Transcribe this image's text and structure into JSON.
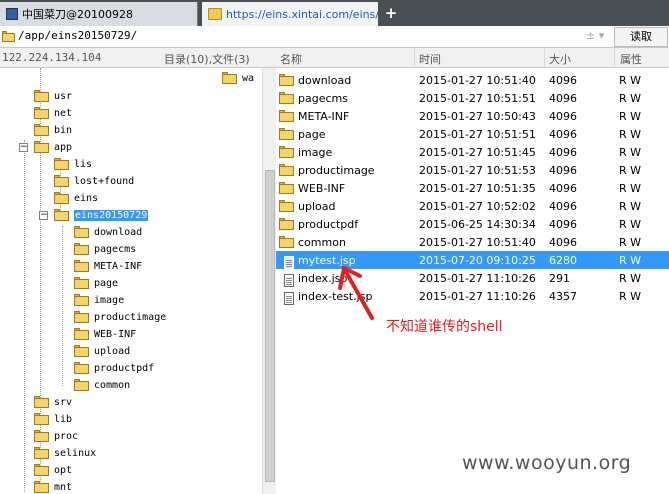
{
  "tabs": [
    {
      "label": "中国菜刀@20100928"
    },
    {
      "label": "https://eins.xintai.com/eins/u..."
    }
  ],
  "new_tab_label": "+",
  "address": {
    "path": "/app/eins20150729/",
    "control": "±  ▾",
    "read_button": "读取"
  },
  "left_status": {
    "ip": "122.224.134.104",
    "count": "目录(10),文件(3)"
  },
  "columns": {
    "name": "名称",
    "time": "时间",
    "size": "大小",
    "attr": "属性"
  },
  "tree": {
    "truncated_top": "wa",
    "items": [
      {
        "label": "usr",
        "depth": 1
      },
      {
        "label": "net",
        "depth": 1
      },
      {
        "label": "bin",
        "depth": 1
      },
      {
        "label": "app",
        "depth": 1,
        "expander": "−"
      },
      {
        "label": "lis",
        "depth": 2
      },
      {
        "label": "lost+found",
        "depth": 2
      },
      {
        "label": "eins",
        "depth": 2
      },
      {
        "label": "eins20150729",
        "depth": 2,
        "expander": "−",
        "selected": true
      },
      {
        "label": "download",
        "depth": 3
      },
      {
        "label": "pagecms",
        "depth": 3
      },
      {
        "label": "META-INF",
        "depth": 3
      },
      {
        "label": "page",
        "depth": 3
      },
      {
        "label": "image",
        "depth": 3
      },
      {
        "label": "productimage",
        "depth": 3
      },
      {
        "label": "WEB-INF",
        "depth": 3
      },
      {
        "label": "upload",
        "depth": 3
      },
      {
        "label": "productpdf",
        "depth": 3
      },
      {
        "label": "common",
        "depth": 3
      },
      {
        "label": "srv",
        "depth": 1
      },
      {
        "label": "lib",
        "depth": 1
      },
      {
        "label": "proc",
        "depth": 1
      },
      {
        "label": "selinux",
        "depth": 1
      },
      {
        "label": "opt",
        "depth": 1
      },
      {
        "label": "mnt",
        "depth": 1
      }
    ]
  },
  "files": [
    {
      "name": "download",
      "time": "2015-01-27 10:51:40",
      "size": "4096",
      "attr": "R W",
      "type": "folder"
    },
    {
      "name": "pagecms",
      "time": "2015-01-27 10:51:51",
      "size": "4096",
      "attr": "R W",
      "type": "folder"
    },
    {
      "name": "META-INF",
      "time": "2015-01-27 10:50:43",
      "size": "4096",
      "attr": "R W",
      "type": "folder"
    },
    {
      "name": "page",
      "time": "2015-01-27 10:51:51",
      "size": "4096",
      "attr": "R W",
      "type": "folder"
    },
    {
      "name": "image",
      "time": "2015-01-27 10:51:45",
      "size": "4096",
      "attr": "R W",
      "type": "folder"
    },
    {
      "name": "productimage",
      "time": "2015-01-27 10:51:53",
      "size": "4096",
      "attr": "R W",
      "type": "folder"
    },
    {
      "name": "WEB-INF",
      "time": "2015-01-27 10:51:35",
      "size": "4096",
      "attr": "R W",
      "type": "folder"
    },
    {
      "name": "upload",
      "time": "2015-01-27 10:52:02",
      "size": "4096",
      "attr": "R W",
      "type": "folder"
    },
    {
      "name": "productpdf",
      "time": "2015-06-25 14:30:34",
      "size": "4096",
      "attr": "R W",
      "type": "folder"
    },
    {
      "name": "common",
      "time": "2015-01-27 10:51:40",
      "size": "4096",
      "attr": "R W",
      "type": "folder"
    },
    {
      "name": "mytest.jsp",
      "time": "2015-07-20 09:10:25",
      "size": "6280",
      "attr": "R W",
      "type": "file",
      "selected": true
    },
    {
      "name": "index.jsp",
      "time": "2015-01-27 11:10:26",
      "size": "291",
      "attr": "R W",
      "type": "file"
    },
    {
      "name": "index-test.jsp",
      "time": "2015-01-27 11:10:26",
      "size": "4357",
      "attr": "R W",
      "type": "file"
    }
  ],
  "annotation": {
    "text": "不知道谁传的shell",
    "color": "#e3201b"
  },
  "watermark": "www.wooyun.org",
  "colors": {
    "selection": "#3399ff",
    "folder": "#f6d46a",
    "tabbar": "#4a4f54"
  }
}
